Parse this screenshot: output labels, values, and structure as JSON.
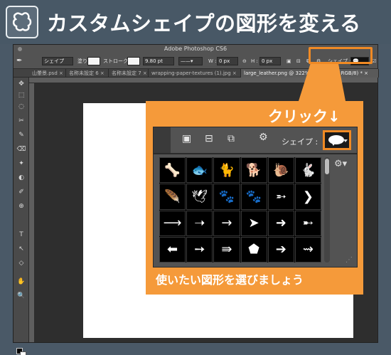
{
  "banner": {
    "title": "カスタムシェイプの図形を変える",
    "icon": "custom-shape-icon"
  },
  "window": {
    "title": "Adobe Photoshop CS6"
  },
  "options_bar": {
    "mode": "シェイプ",
    "fill_label": "塗り :",
    "stroke_label": "ストローク :",
    "stroke_width": "9.80 pt",
    "w_label": "W :",
    "w_value": "0 px",
    "h_label": "H :",
    "h_value": "0 px",
    "shape_label": "シェイプ :"
  },
  "tabs": [
    {
      "label": "山暈景.psd ×",
      "active": false
    },
    {
      "label": "名称未設定 6 ×",
      "active": false
    },
    {
      "label": "名称未設定 7 ×",
      "active": false
    },
    {
      "label": "wrapping-paper-textures (1).jpg ×",
      "active": false
    },
    {
      "label": "large_leather.png @ 322% (べた塗り 1, RGB/8) * ×",
      "active": true
    }
  ],
  "tools": [
    "✥",
    "⬚",
    "◌",
    "✂",
    "✎",
    "⌫",
    "✦",
    "◐",
    "✐",
    "⊕",
    "T",
    "↖",
    "◇",
    "✋",
    "🔍"
  ],
  "zoom_panel": {
    "click_label": "クリック↓",
    "shape_label": "シェイプ :",
    "caption": "使いたい図形を選びましょう",
    "accent_color": "#f59a3a"
  },
  "shapes": [
    {
      "glyph": "🦴",
      "name": "bone-shape"
    },
    {
      "glyph": "🐟",
      "name": "fish-shape"
    },
    {
      "glyph": "🐈",
      "name": "cat-shape"
    },
    {
      "glyph": "🐕",
      "name": "dog-shape"
    },
    {
      "glyph": "🐌",
      "name": "snail-shape"
    },
    {
      "glyph": "🐇",
      "name": "rabbit-shape"
    },
    {
      "glyph": "🪶",
      "name": "feather-shape"
    },
    {
      "glyph": "🕊",
      "name": "bird-shape"
    },
    {
      "glyph": "🐾",
      "name": "paw-print-shape"
    },
    {
      "glyph": "🐾",
      "name": "paw-prints-shape"
    },
    {
      "glyph": "➵",
      "name": "arrow-feather-shape"
    },
    {
      "glyph": "❯",
      "name": "chevron-shape"
    },
    {
      "glyph": "⟶",
      "name": "thin-arrow-shape"
    },
    {
      "glyph": "➝",
      "name": "arrow-2-shape"
    },
    {
      "glyph": "→",
      "name": "arrow-3-shape"
    },
    {
      "glyph": "➤",
      "name": "arrowhead-shape"
    },
    {
      "glyph": "➜",
      "name": "bold-arrow-shape"
    },
    {
      "glyph": "➸",
      "name": "arrow-6-shape"
    },
    {
      "glyph": "⬅",
      "name": "block-arrow-shape"
    },
    {
      "glyph": "➙",
      "name": "arrow-8-shape"
    },
    {
      "glyph": "⇛",
      "name": "triple-arrow-shape"
    },
    {
      "glyph": "⬟",
      "name": "pentagon-arrow-shape"
    },
    {
      "glyph": "➔",
      "name": "arrow-11-shape"
    },
    {
      "glyph": "⇝",
      "name": "wavy-arrow-shape"
    }
  ]
}
